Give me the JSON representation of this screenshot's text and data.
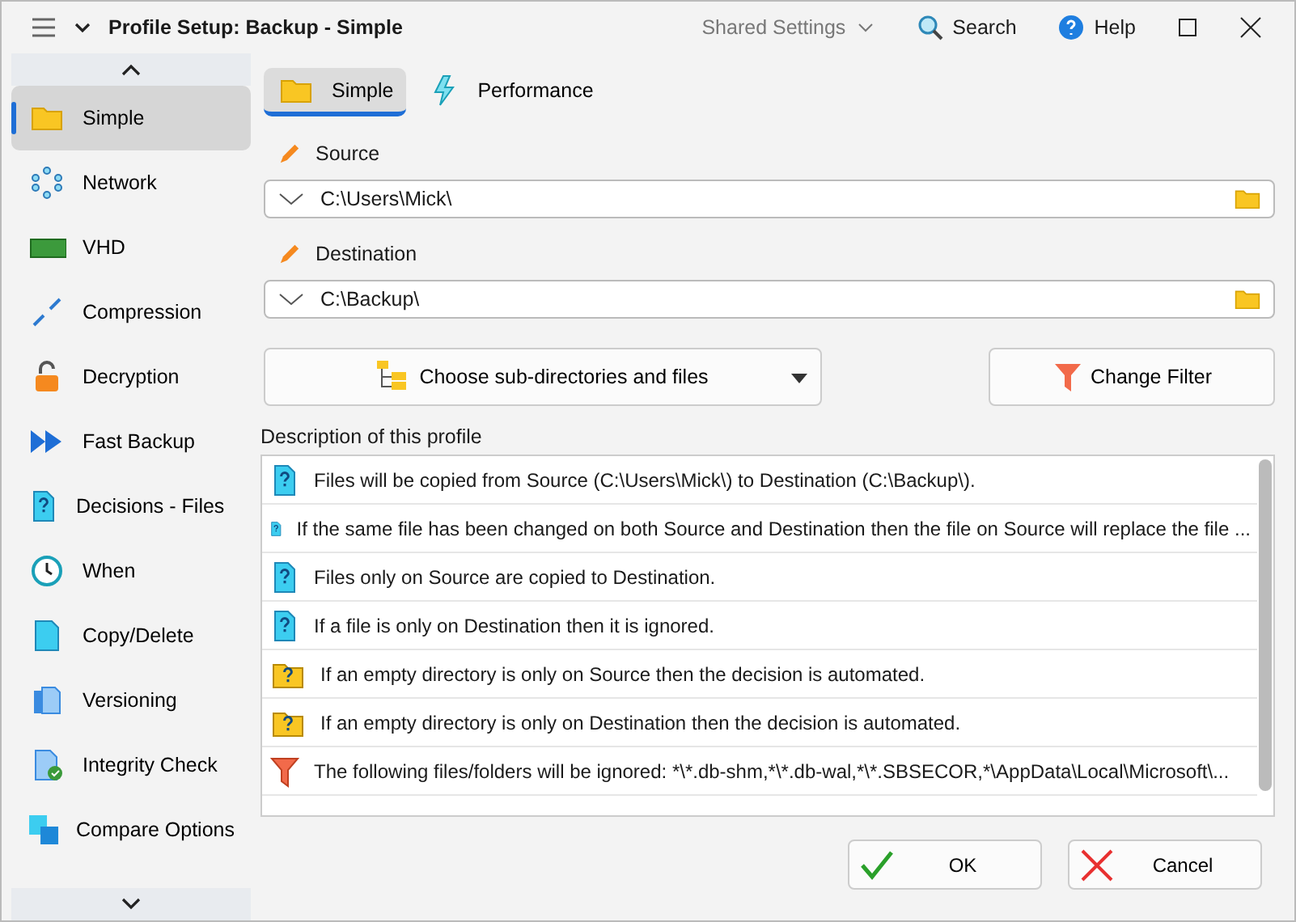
{
  "window": {
    "title": "Profile Setup: Backup - Simple",
    "shared_settings": "Shared Settings",
    "search": "Search",
    "help": "Help"
  },
  "sidebar": {
    "items": [
      {
        "label": "Simple",
        "selected": true
      },
      {
        "label": "Network",
        "selected": false
      },
      {
        "label": "VHD",
        "selected": false
      },
      {
        "label": "Compression",
        "selected": false
      },
      {
        "label": "Decryption",
        "selected": false
      },
      {
        "label": "Fast Backup",
        "selected": false
      },
      {
        "label": "Decisions - Files",
        "selected": false
      },
      {
        "label": "When",
        "selected": false
      },
      {
        "label": "Copy/Delete",
        "selected": false
      },
      {
        "label": "Versioning",
        "selected": false
      },
      {
        "label": "Integrity Check",
        "selected": false
      },
      {
        "label": "Compare Options",
        "selected": false
      }
    ]
  },
  "tabs": [
    {
      "label": "Simple",
      "selected": true
    },
    {
      "label": "Performance",
      "selected": false
    }
  ],
  "source": {
    "label": "Source",
    "value": "C:\\Users\\Mick\\"
  },
  "destination": {
    "label": "Destination",
    "value": "C:\\Backup\\"
  },
  "choose_button": "Choose sub-directories and files",
  "filter_button": "Change Filter",
  "description": {
    "label": "Description of this profile",
    "rows": [
      {
        "kind": "file",
        "text": "Files will be copied from Source (C:\\Users\\Mick\\) to Destination (C:\\Backup\\)."
      },
      {
        "kind": "file",
        "text": "If the same file has been changed on both Source and Destination then the file on Source will replace the file ..."
      },
      {
        "kind": "file",
        "text": "Files only on Source are copied to Destination."
      },
      {
        "kind": "file",
        "text": "If a file is only on Destination then it is ignored."
      },
      {
        "kind": "folder",
        "text": "If an empty directory is only on Source then the decision is automated."
      },
      {
        "kind": "folder",
        "text": "If an empty directory is only on Destination then the decision is automated."
      },
      {
        "kind": "filter",
        "text": "The following files/folders will be ignored: *\\*.db-shm,*\\*.db-wal,*\\*.SBSECOR,*\\AppData\\Local\\Microsoft\\..."
      }
    ]
  },
  "buttons": {
    "ok": "OK",
    "cancel": "Cancel"
  }
}
